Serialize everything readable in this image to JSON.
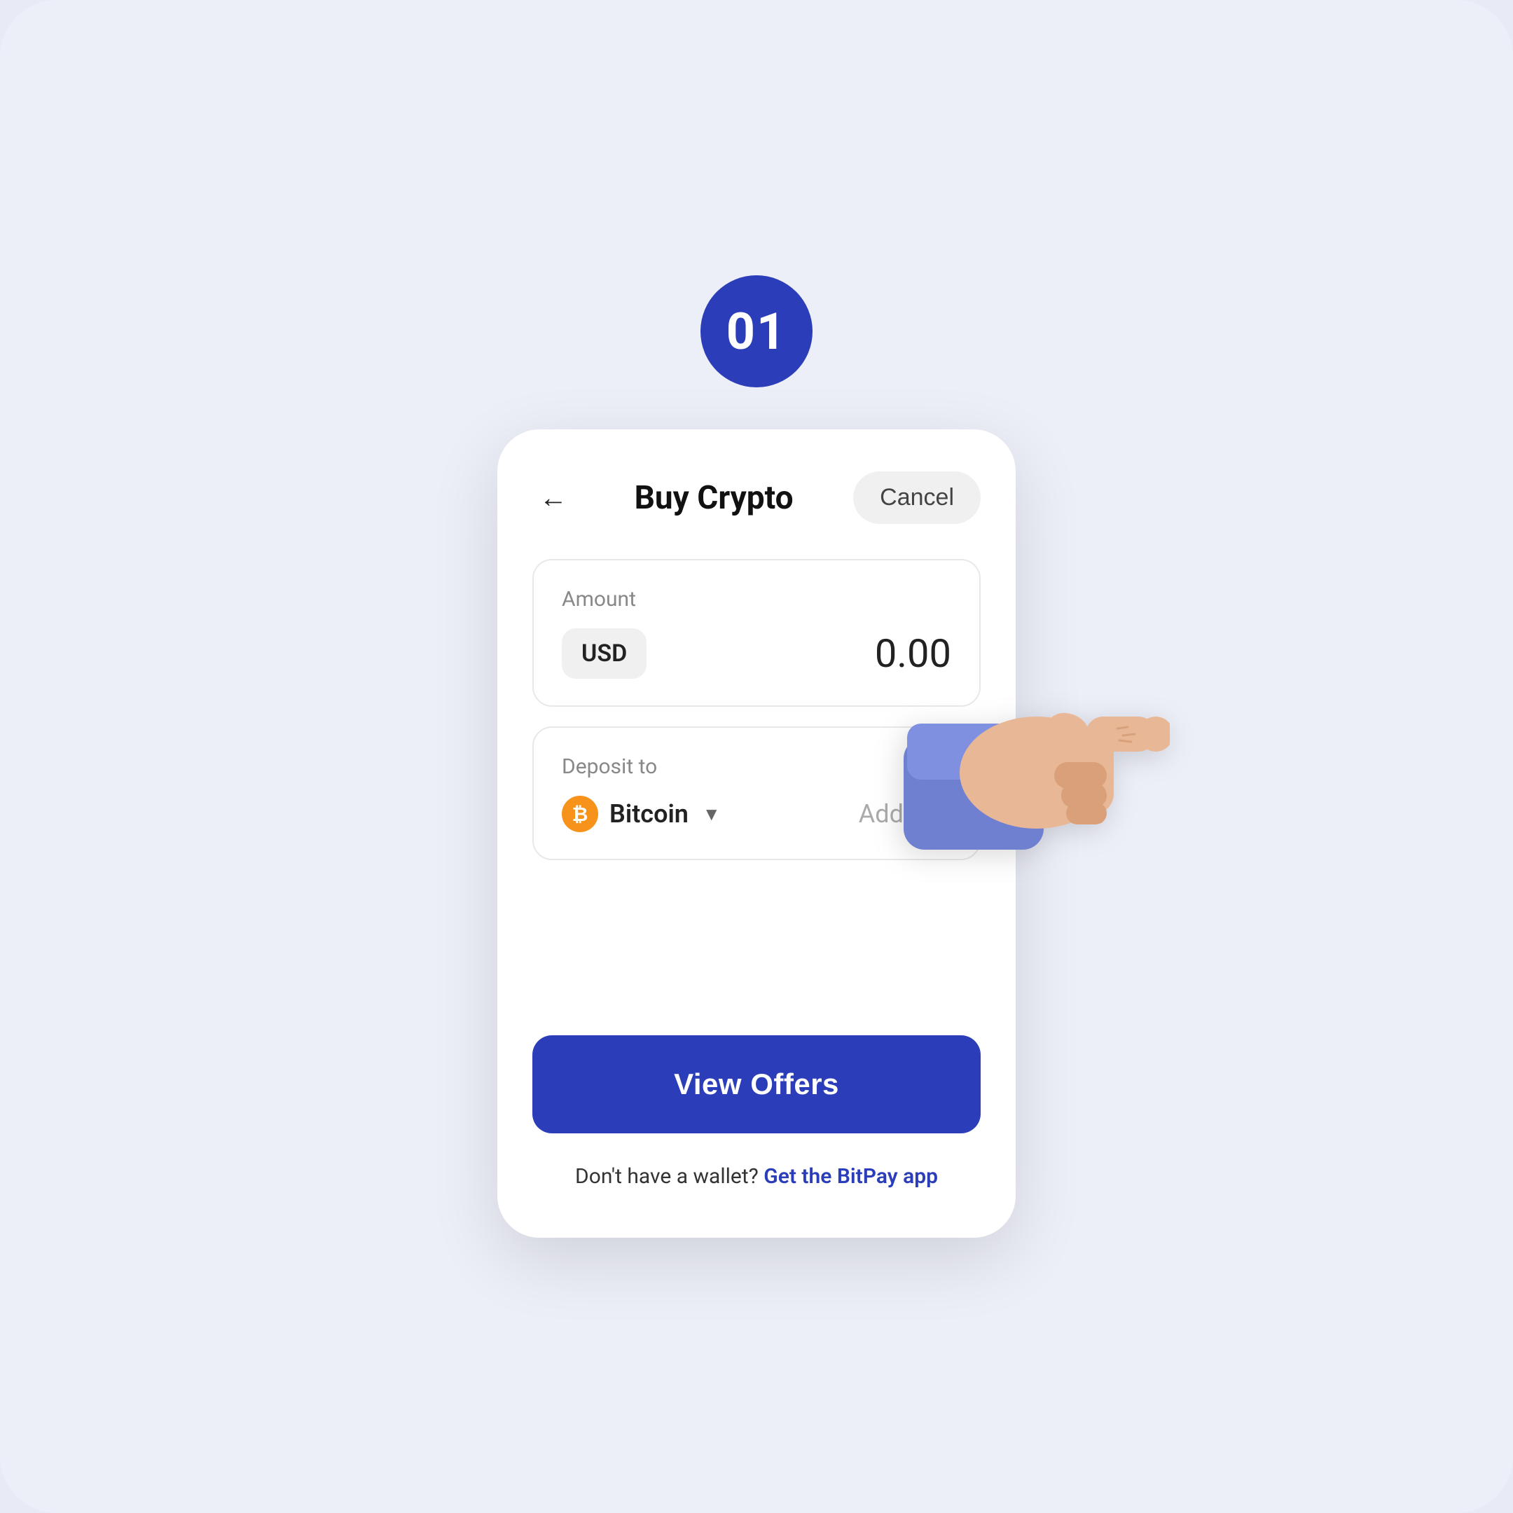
{
  "step": {
    "number": "01"
  },
  "header": {
    "title": "Buy Crypto",
    "cancel_label": "Cancel",
    "back_label": "←"
  },
  "amount_section": {
    "label": "Amount",
    "currency": "USD",
    "value": "0.00"
  },
  "deposit_section": {
    "label": "Deposit to",
    "coin_name": "Bitcoin",
    "address_placeholder": "Address"
  },
  "cta": {
    "button_label": "View Offers"
  },
  "footer": {
    "text": "Don't have a wallet?",
    "link_text": "Get the BitPay app"
  }
}
